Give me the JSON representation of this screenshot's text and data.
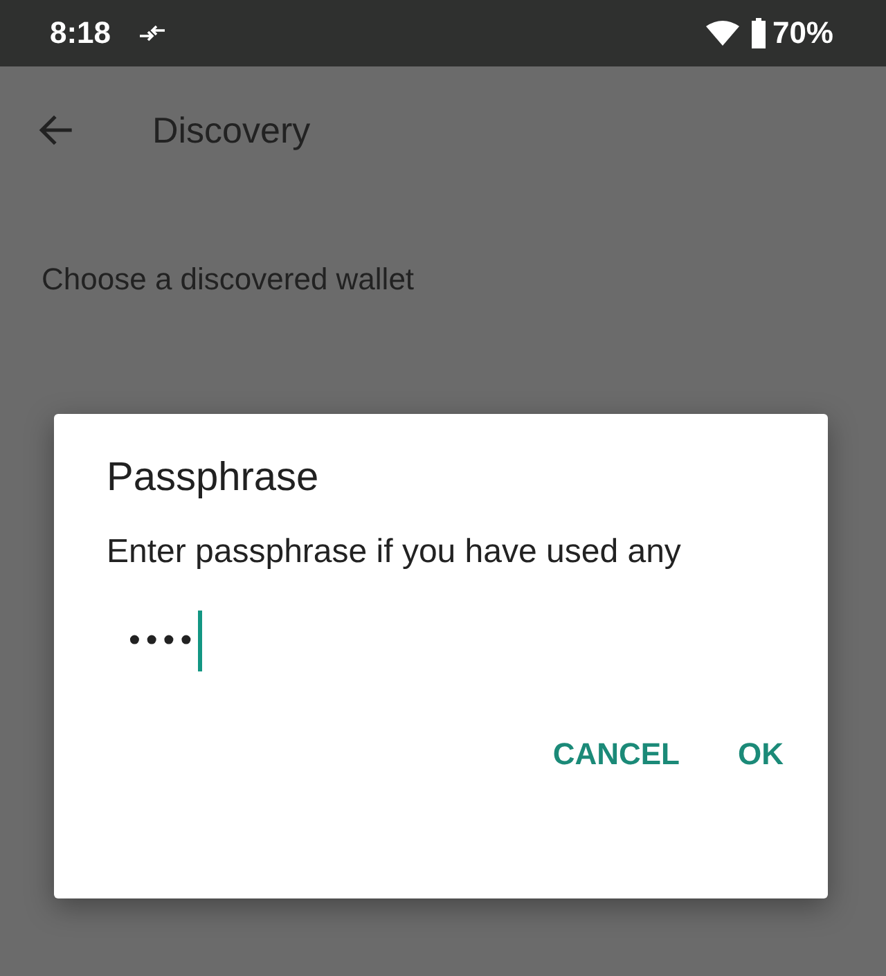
{
  "status_bar": {
    "time": "8:18",
    "battery": "70%"
  },
  "toolbar": {
    "title": "Discovery"
  },
  "content": {
    "heading": "Choose a discovered wallet"
  },
  "dialog": {
    "title": "Passphrase",
    "message": "Enter passphrase if you have used any",
    "field": {
      "value": "••••",
      "focused": true
    },
    "buttons": [
      {
        "label": "CANCEL"
      },
      {
        "label": "OK"
      }
    ]
  }
}
